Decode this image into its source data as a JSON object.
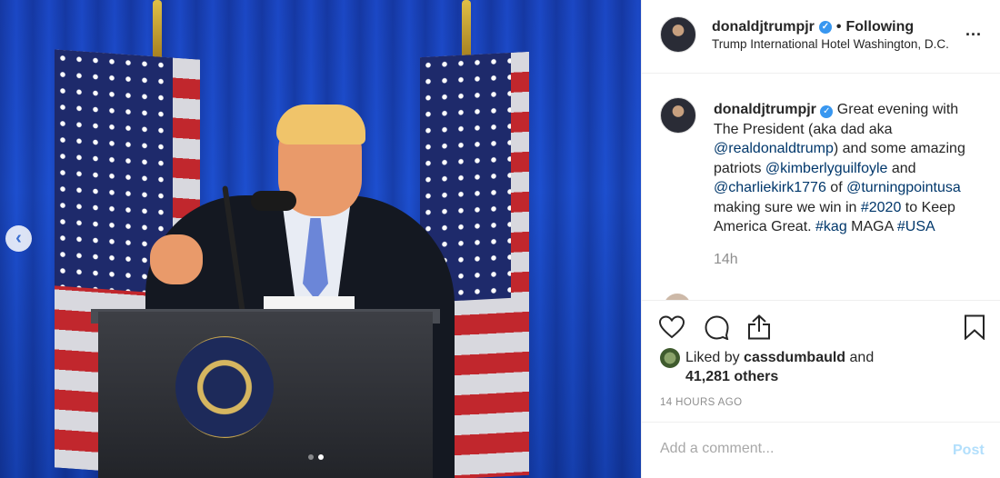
{
  "post": {
    "username": "donaldjtrumpjr",
    "verified_badge": "✓",
    "separator": "•",
    "follow_status": "Following",
    "location": "Trump International Hotel Washington, D.C.",
    "more_label": "...",
    "caption": {
      "username": "donaldjtrumpjr",
      "parts": [
        {
          "text": "Great evening with The President (aka dad aka ",
          "type": "text"
        },
        {
          "text": "@realdonaldtrump",
          "type": "mention"
        },
        {
          "text": ") and some amazing patriots ",
          "type": "text"
        },
        {
          "text": "@kimberlyguilfoyle",
          "type": "mention"
        },
        {
          "text": " and ",
          "type": "text"
        },
        {
          "text": "@charliekirk1776",
          "type": "mention"
        },
        {
          "text": " of ",
          "type": "text"
        },
        {
          "text": "@turningpointusa",
          "type": "mention"
        },
        {
          "text": " making sure we win in ",
          "type": "text"
        },
        {
          "text": "#2020",
          "type": "mention"
        },
        {
          "text": " to Keep America Great. ",
          "type": "text"
        },
        {
          "text": "#kag",
          "type": "mention"
        },
        {
          "text": " MAGA ",
          "type": "text"
        },
        {
          "text": "#USA",
          "type": "mention"
        }
      ]
    },
    "age": "14h",
    "likes": {
      "prefix": "Liked by ",
      "user": "cassdumbauld",
      "middle": " and",
      "others": "41,281 others"
    },
    "timestamp": "14 HOURS AGO",
    "comment": {
      "placeholder": "Add a comment...",
      "post_label": "Post"
    },
    "carousel": {
      "prev_icon": "chevron-left-icon",
      "slide_count": 2,
      "active_slide": 2
    },
    "icons": {
      "like": "heart-icon",
      "comment": "comment-icon",
      "share": "share-icon",
      "save": "bookmark-icon"
    },
    "colors": {
      "mention": "#00376b",
      "verified": "#3897f0",
      "post_button": "#b2dffc"
    }
  }
}
